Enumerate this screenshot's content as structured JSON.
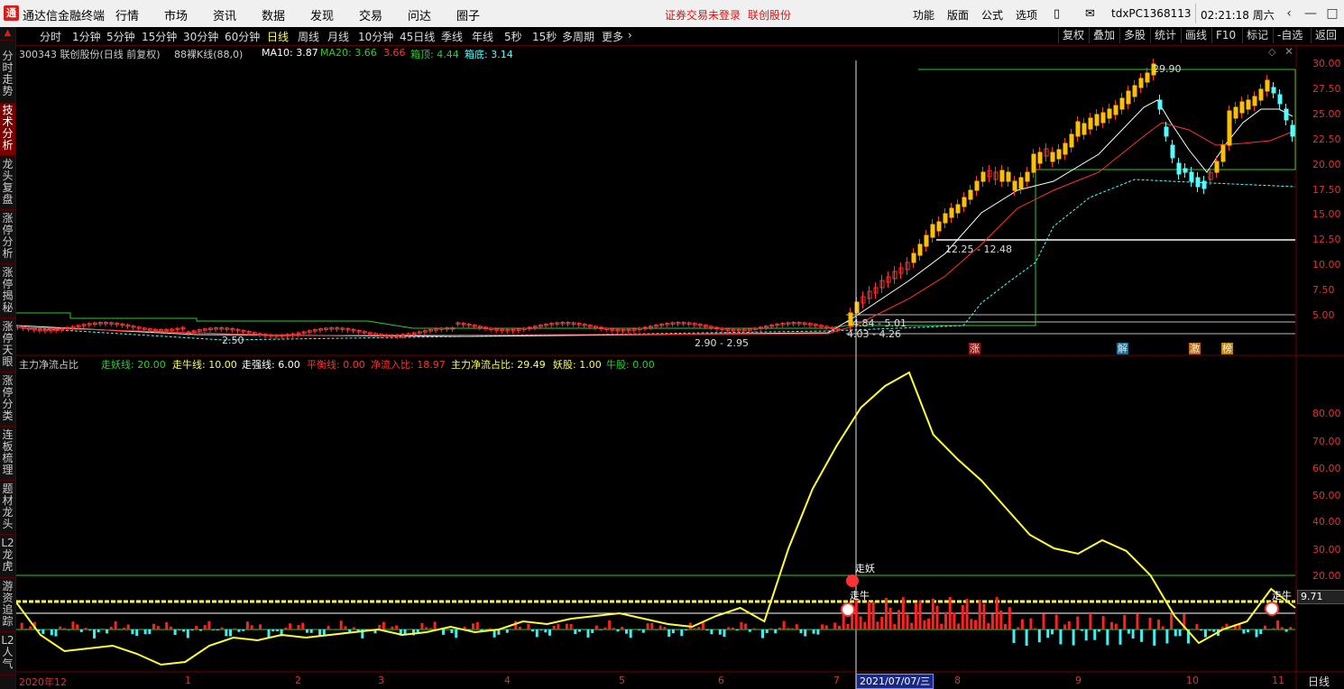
{
  "app": {
    "title": "通达信金融终端",
    "menu": [
      "行情",
      "市场",
      "资讯",
      "数据",
      "发现",
      "交易",
      "问达",
      "圈子"
    ],
    "warning": "证券交易未登录",
    "stock_name_link": "联创股份",
    "right_menu": [
      "功能",
      "版面",
      "公式",
      "选项"
    ],
    "user": "tdxPC1368113",
    "clock": "02:21:18 周六"
  },
  "toolbar": {
    "periods": [
      "分时",
      "1分钟",
      "5分钟",
      "15分钟",
      "30分钟",
      "60分钟",
      "日线",
      "周线",
      "月线",
      "10分钟",
      "45日线",
      "季线",
      "年线",
      "5秒",
      "15秒",
      "多周期",
      "更多"
    ],
    "active_period": "日线",
    "right": [
      "复权",
      "叠加",
      "多股",
      "统计",
      "画线",
      "F10",
      "标记",
      "-自选",
      "返回"
    ]
  },
  "left_tabs": [
    {
      "label": "分时走势",
      "active": false
    },
    {
      "label": "技术分析",
      "active": true
    },
    {
      "label": "龙头复盘",
      "active": false
    },
    {
      "label": "涨停分析",
      "active": false
    },
    {
      "label": "涨停揭秘",
      "active": false
    },
    {
      "label": "涨停天眼",
      "active": false
    },
    {
      "label": "涨停分类",
      "active": false
    },
    {
      "label": "连板梳理",
      "active": false
    },
    {
      "label": "题材龙头",
      "active": false
    },
    {
      "label": "L2龙虎",
      "active": false
    },
    {
      "label": "游资追踪",
      "active": false
    },
    {
      "label": "L2人气",
      "active": false
    }
  ],
  "main_info": {
    "stock": "300343 联创股份(日线 前复权)",
    "k": "88裸K线(88,0)",
    "ma10": "MA10: 3.87",
    "ma20": "MA20: 3.66",
    "ma20b": "3.66",
    "box_top": "箱顶: 4.44",
    "box_bottom": "箱底: 3.14"
  },
  "main_axis": [
    "30.00",
    "27.50",
    "25.00",
    "22.50",
    "20.00",
    "17.50",
    "15.00",
    "12.50",
    "10.00",
    "7.50",
    "5.00"
  ],
  "price_notes": {
    "high": "29.90",
    "range1": "12.25 - 12.48",
    "range2": "4.84 - 5.01",
    "range3": "4.03 - 4.26",
    "low": "2.50",
    "low2": "2.90 - 2.95"
  },
  "event_tags": [
    "涨",
    "解",
    "激",
    "榜"
  ],
  "sub_info": {
    "name": "主力净流占比",
    "walk_demon": "走妖线: 20.00",
    "walk_bull": "走牛线: 10.00",
    "walk_strong": "走强线: 6.00",
    "balance": "平衡线: 0.00",
    "net_in": "净流入比: 18.97",
    "main_ratio": "主力净流占比: 29.49",
    "demon_stock": "妖股: 1.00",
    "bull_stock": "牛股: 0.00"
  },
  "sub_axis": [
    "80.00",
    "70.00",
    "60.00",
    "50.00",
    "40.00",
    "30.00",
    "20.00",
    "10.00"
  ],
  "sub_current": "9.71",
  "sub_marks": {
    "demon": "走妖",
    "bull": "走牛",
    "bull2": "走牛"
  },
  "date_axis": [
    "2020年12",
    "1",
    "2",
    "3",
    "4",
    "5",
    "6",
    "7",
    "8",
    "9",
    "10",
    "11"
  ],
  "cursor_date": "2021/07/07/三",
  "period_label": "日线",
  "colors": {
    "up": "#ff3333",
    "down": "#54ffff",
    "yellow": "#ffff33",
    "gold": "#ffc000",
    "green": "#2ecc2e",
    "grid": "#6b0000"
  },
  "chart_data": {
    "type": "line",
    "series": [
      {
        "name": "主力净流占比",
        "values": [
          10,
          -2,
          -8,
          -7,
          -6,
          -9,
          -13,
          -12,
          -6,
          -3,
          -4,
          -2,
          -3,
          -2,
          -1,
          0,
          -2,
          -1,
          1,
          -1,
          0,
          3,
          2,
          4,
          5,
          6,
          4,
          2,
          1,
          5,
          8,
          3,
          30,
          52,
          68,
          82,
          90,
          95,
          72,
          63,
          55,
          45,
          35,
          30,
          28,
          33,
          29,
          20,
          5,
          -5,
          0,
          3,
          15,
          8
        ]
      },
      {
        "name": "走妖线",
        "values": [
          20
        ]
      },
      {
        "name": "走牛线",
        "values": [
          10
        ]
      },
      {
        "name": "走强线",
        "values": [
          6
        ]
      },
      {
        "name": "平衡线",
        "values": [
          0
        ]
      }
    ],
    "ylim": [
      -15,
      95
    ]
  }
}
